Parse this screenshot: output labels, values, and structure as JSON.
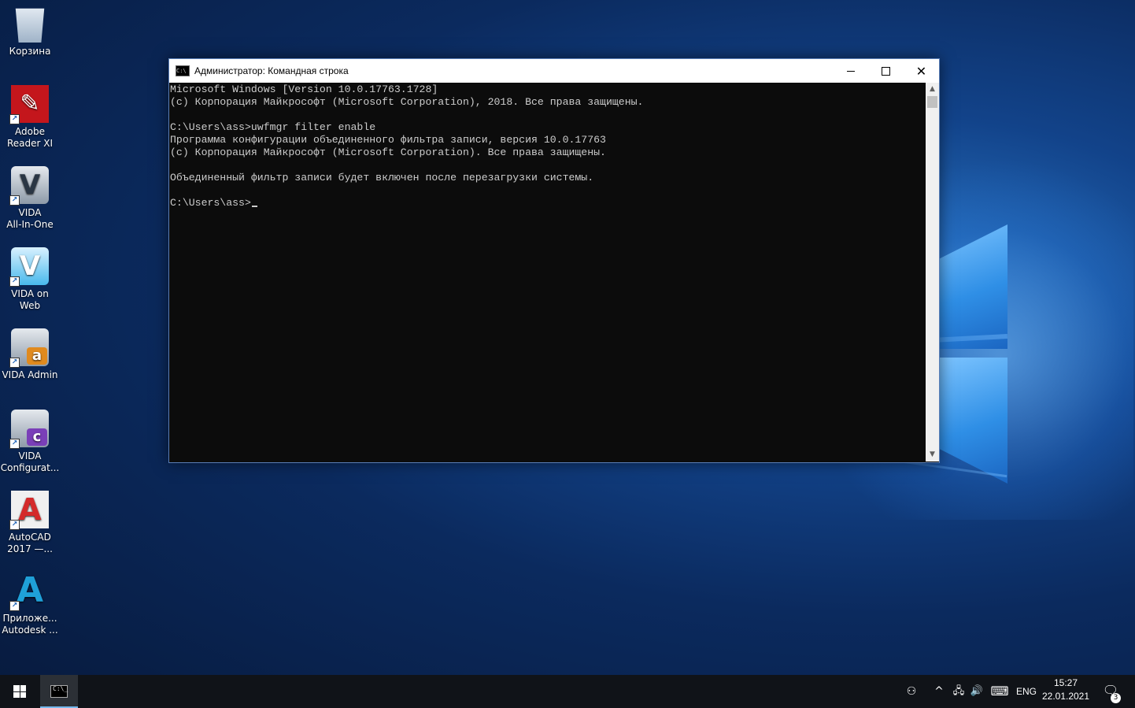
{
  "desktop": {
    "icons": [
      {
        "label_1": "Корзина",
        "label_2": "",
        "icon": "recycle-bin-icon"
      },
      {
        "label_1": "Adobe",
        "label_2": "Reader XI",
        "icon": "adobe-reader-icon",
        "glyph": "✎"
      },
      {
        "label_1": "VIDA",
        "label_2": "All-In-One",
        "icon": "vida-icon",
        "glyph": "V"
      },
      {
        "label_1": "VIDA on Web",
        "label_2": "",
        "icon": "vida-web-icon",
        "glyph": "V"
      },
      {
        "label_1": "VIDA Admin",
        "label_2": "",
        "icon": "vida-admin-icon",
        "glyph": "a"
      },
      {
        "label_1": "VIDA",
        "label_2": "Configurat...",
        "icon": "vida-config-icon",
        "glyph": "c"
      },
      {
        "label_1": "AutoCAD",
        "label_2": "2017 —...",
        "icon": "autocad-icon",
        "glyph": "A"
      },
      {
        "label_1": "Приложе...",
        "label_2": "Autodesk ...",
        "icon": "autodesk-icon",
        "glyph": "A"
      }
    ]
  },
  "window": {
    "title": "Администратор: Командная строка",
    "icon_text": "C:\\",
    "minimize": "—",
    "close": "✕"
  },
  "console": {
    "lines": [
      "Microsoft Windows [Version 10.0.17763.1728]",
      "(c) Корпорация Майкрософт (Microsoft Corporation), 2018. Все права защищены.",
      "",
      "C:\\Users\\ass>uwfmgr filter enable",
      "Программа конфигурации объединенного фильтра записи, версия 10.0.17763",
      "(c) Корпорация Майкрософт (Microsoft Corporation). Все права защищены.",
      "",
      "Объединенный фильтр записи будет включен после перезагрузки системы.",
      "",
      "C:\\Users\\ass>"
    ]
  },
  "scrollbar": {
    "up": "▲",
    "down": "▼"
  },
  "taskbar": {
    "cmd_icon_text": "C:\\_",
    "tray": {
      "people": "⚇",
      "chevron": "^",
      "network": "🖧",
      "volume": "🔊",
      "keyboard": "⌨",
      "language": "ENG",
      "time": "15:27",
      "date": "22.01.2021",
      "notification_count": "3",
      "notification": "🗨"
    }
  }
}
